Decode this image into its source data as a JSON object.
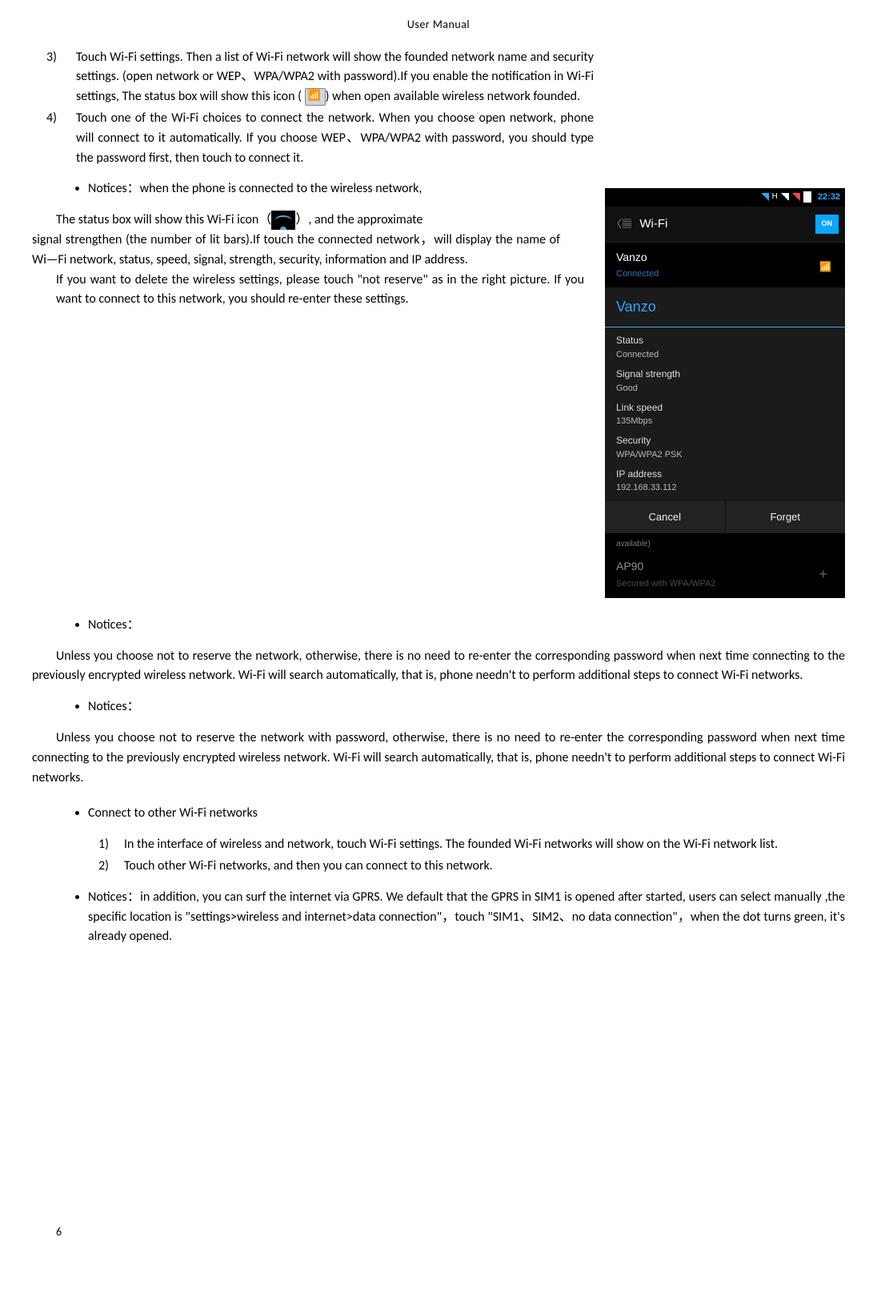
{
  "header": "User    Manual",
  "step3": "Touch Wi-Fi settings. Then a list of Wi-Fi network will show the founded network name and security settings. (open network or WEP、WPA/WPA2 with password).If you enable the notification in   Wi-Fi settings, The status box will show this icon (",
  "step3b": ") when open available wireless network founded.",
  "step4": "Touch one of the Wi-Fi choices to connect the network. When you choose open network, phone will connect to it automatically. If you choose WEP、WPA/WPA2 with password, you should type the password first, then touch to connect it.",
  "notice1": "Notices：when the phone is connected to the wireless network,",
  "wifi_line_a": "The status box will show this Wi-Fi icon（",
  "wifi_line_b": "）, and the approximate",
  "p1": "signal strengthen (the number of lit bars).If touch the connected network，will display the name of Wi—Fi   network, status, speed,   signal, strength, security, information and IP address.",
  "p2": "If you want to delete the wireless settings, please touch \"not reserve\" as in the right picture. If you want to connect to this network, you should re-enter these settings.",
  "notice2": "Notices：",
  "p3": "Unless you choose not to reserve the network, otherwise, there is no need to re-enter the corresponding password when next time connecting to the previously encrypted wireless network. Wi-Fi will search automatically, that is, phone needn't to perform additional steps to connect Wi-Fi networks.",
  "notice3": "Notices：",
  "p4": "Unless you choose not to reserve the network with password, otherwise, there is no need to re-enter the corresponding password when next time connecting to the previously encrypted wireless network. Wi-Fi will search automatically, that is, phone needn't to perform additional steps to connect Wi-Fi networks.",
  "connect_other": "Connect to other Wi-Fi networks",
  "co1": "In the interface of wireless and network, touch Wi-Fi settings. The founded Wi-Fi networks will show on the Wi-Fi network list.",
  "co2": "Touch other Wi-Fi networks, and then you can connect to this network.",
  "notice4": "Notices：in addition, you can surf the internet via GPRS. We default that the GPRS in SIM1 is opened after started, users can select manually ,the specific location is  \"settings>wireless and internet>data connection\"，touch \"SIM1、SIM2、no data connection\"，when the dot turns green, it's already opened.",
  "shot": {
    "clock": "22:32",
    "title": "Wi-Fi",
    "toggle": "ON",
    "net1_name": "Vanzo",
    "net1_sub": "Connected",
    "dialog_title": "Vanzo",
    "status_lbl": "Status",
    "status_val": "Connected",
    "sig_lbl": "Signal strength",
    "sig_val": "Good",
    "spd_lbl": "Link speed",
    "spd_val": "135Mbps",
    "sec_lbl": "Security",
    "sec_val": "WPA/WPA2 PSK",
    "ip_lbl": "IP address",
    "ip_val": "192.168.33.112",
    "btn_cancel": "Cancel",
    "btn_forget": "Forget",
    "avail": "available)",
    "ap90": "AP90",
    "ap90_sub": "Secured with WPA/WPA2"
  },
  "page": "6"
}
